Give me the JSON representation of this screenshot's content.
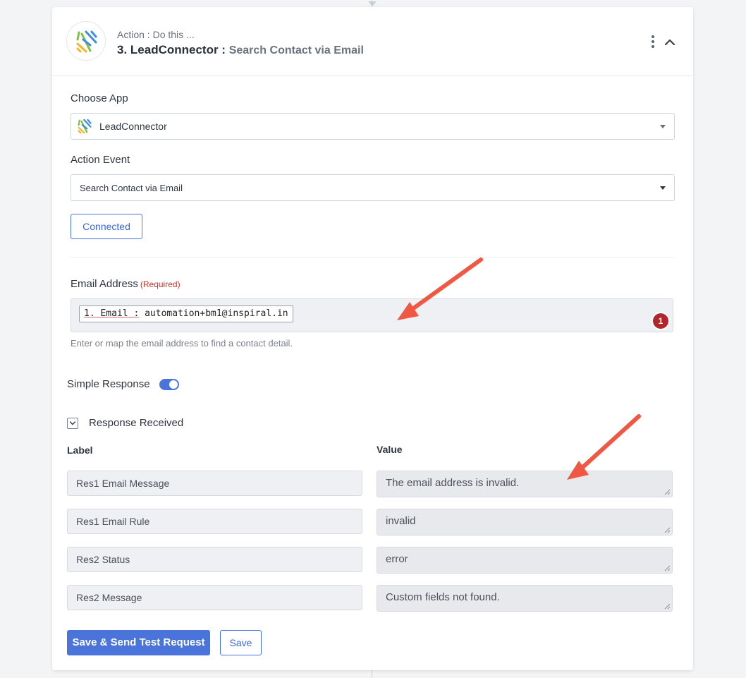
{
  "header": {
    "subtitle": "Action : Do this ...",
    "step_title": "3. LeadConnector :",
    "step_event": "Search Contact via Email"
  },
  "choose_app": {
    "label": "Choose App",
    "value": "LeadConnector"
  },
  "action_event": {
    "label": "Action Event",
    "value": "Search Contact via Email"
  },
  "connection": {
    "button_label": "Connected"
  },
  "email_field": {
    "label": "Email Address",
    "required_text": "(Required)",
    "token_key": "1. Email :",
    "token_value": "automation+bm1@inspiral.in",
    "error_count": "1",
    "help_text": "Enter or map the email address to find a contact detail."
  },
  "simple_response": {
    "label": "Simple Response",
    "enabled": true
  },
  "response": {
    "toggle_label": "Response Received",
    "label_header": "Label",
    "value_header": "Value",
    "rows": [
      {
        "label": "Res1 Email Message",
        "value": "The email address is invalid."
      },
      {
        "label": "Res1 Email Rule",
        "value": "invalid"
      },
      {
        "label": "Res2 Status",
        "value": "error"
      },
      {
        "label": "Res2 Message",
        "value": "Custom fields not found."
      }
    ]
  },
  "actions": {
    "primary_label": "Save & Send Test Request",
    "secondary_label": "Save"
  },
  "colors": {
    "accent": "#4a74d9",
    "error_badge": "#b0262b",
    "annotation_arrow": "#ef5944"
  },
  "icons": {
    "app_logo": "leadconnector-logo-icon",
    "menu": "kebab-menu-icon",
    "collapse": "chevron-up-icon",
    "dropdown": "caret-down-icon",
    "expand_toggle": "chevron-down-icon"
  }
}
